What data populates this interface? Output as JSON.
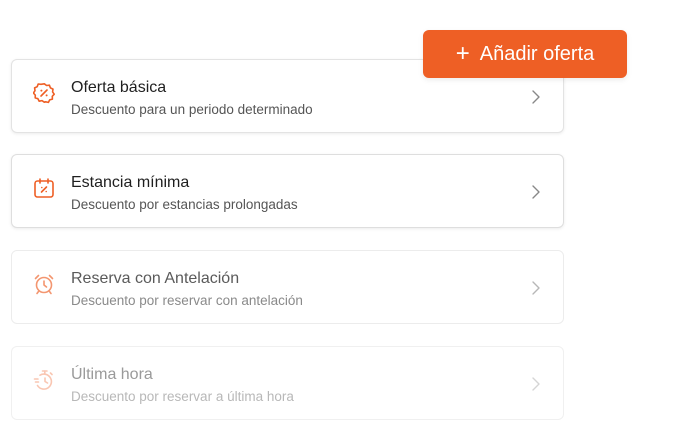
{
  "add_button": {
    "plus": "+",
    "label": "Añadir oferta"
  },
  "colors": {
    "accent": "#ee5f25",
    "border": "#e3e3e3"
  },
  "offers": [
    {
      "title": "Oferta básica",
      "description": "Descuento para un periodo determinado",
      "icon": "discount-badge-icon"
    },
    {
      "title": "Estancia mínima",
      "description": "Descuento por estancias prolongadas",
      "icon": "calendar-percent-icon"
    },
    {
      "title": "Reserva con Antelación",
      "description": "Descuento por reservar con antelación",
      "icon": "alarm-clock-icon"
    },
    {
      "title": "Última hora",
      "description": "Descuento por reservar a última hora",
      "icon": "fast-timer-icon"
    }
  ]
}
